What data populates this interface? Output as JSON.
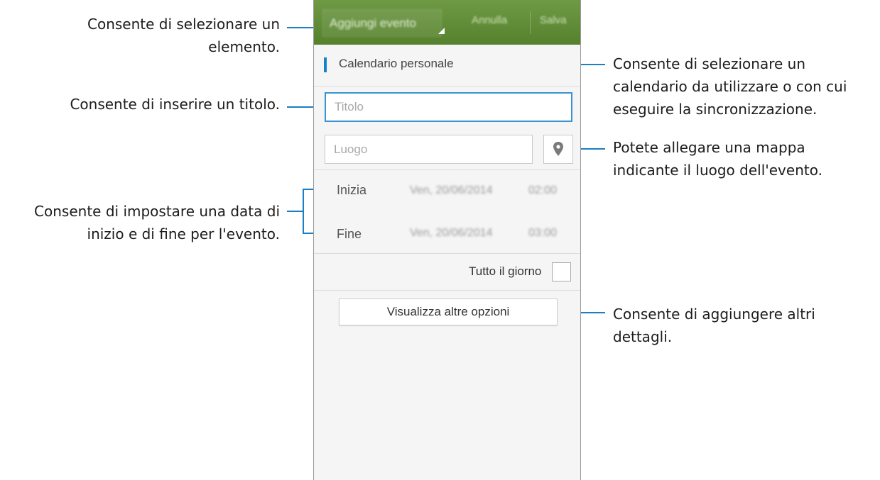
{
  "callouts": {
    "select_item": [
      "Consente di selezionare un",
      "elemento."
    ],
    "enter_title": "Consente di inserire un titolo.",
    "set_dates": [
      "Consente di impostare una data di",
      "inizio e di fine per l'evento."
    ],
    "select_calendar": [
      "Consente di selezionare un",
      "calendario da utilizzare o con cui",
      "eseguire la sincronizzazione."
    ],
    "attach_map": [
      "Potete allegare una mappa",
      "indicante il luogo dell'evento."
    ],
    "add_details": [
      "Consente di aggiungere altri",
      "dettagli."
    ]
  },
  "actionbar": {
    "title": "Aggiungi evento",
    "cancel_label": "Annulla",
    "save_label": "Salva",
    "color": "#5f8b36"
  },
  "calendar": {
    "label": "Calendario personale",
    "accent": "#1583c7"
  },
  "title_field": {
    "placeholder": "Titolo"
  },
  "location_field": {
    "placeholder": "Luogo",
    "icon": "map-pin-icon"
  },
  "start": {
    "label": "Inizia",
    "date": "Ven, 20/06/2014",
    "time": "02:00"
  },
  "end": {
    "label": "Fine",
    "date": "Ven, 20/06/2014",
    "time": "03:00"
  },
  "all_day": {
    "label": "Tutto il giorno",
    "checked": false
  },
  "more_options": {
    "label": "Visualizza altre opzioni"
  }
}
